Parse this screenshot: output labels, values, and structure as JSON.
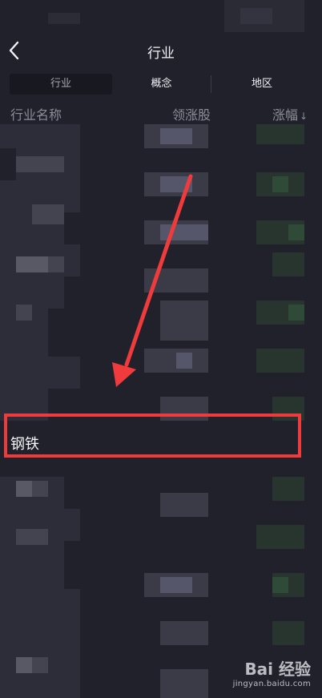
{
  "header": {
    "back_icon": "chevron-left-icon",
    "title": "行业"
  },
  "tabs": [
    {
      "label": "行业",
      "active": true
    },
    {
      "label": "概念",
      "active": false
    },
    {
      "label": "地区",
      "active": false
    }
  ],
  "columns": {
    "name": "行业名称",
    "leader": "领涨股",
    "change": "涨幅",
    "sort_icon": "arrow-down-icon"
  },
  "highlight": {
    "label": "钢铁"
  },
  "annotation": {
    "arrow_color": "#ef3b3b",
    "box_color": "#ef3b3b"
  },
  "watermark": {
    "logo": "Bai 经验",
    "url": "jingyan.baidu.com"
  },
  "colors": {
    "background": "#20212b",
    "positive": "#2a4a32"
  }
}
